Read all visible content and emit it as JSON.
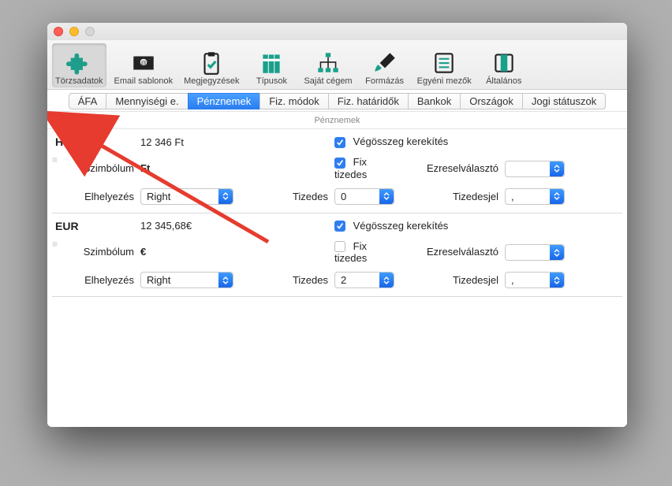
{
  "toolbar": [
    {
      "id": "torzsadatok",
      "label": "Törzsadatok"
    },
    {
      "id": "email",
      "label": "Email sablonok"
    },
    {
      "id": "megjegyzesek",
      "label": "Megjegyzések"
    },
    {
      "id": "tipusok",
      "label": "Típusok"
    },
    {
      "id": "sajat",
      "label": "Saját cégem"
    },
    {
      "id": "formazas",
      "label": "Formázás"
    },
    {
      "id": "egyeni",
      "label": "Egyéni mezők"
    },
    {
      "id": "altalanos",
      "label": "Általános"
    }
  ],
  "tabs": [
    {
      "label": "ÁFA"
    },
    {
      "label": "Mennyiségi e."
    },
    {
      "label": "Pénznemek",
      "active": true
    },
    {
      "label": "Fiz. módok"
    },
    {
      "label": "Fiz. határidők"
    },
    {
      "label": "Bankok"
    },
    {
      "label": "Országok"
    },
    {
      "label": "Jogi státuszok"
    }
  ],
  "listHeader": {
    "add": "+",
    "remove": "–",
    "title": "Pénznemek"
  },
  "labels": {
    "szimbolum": "Szimbólum",
    "elhelyezes": "Elhelyezés",
    "tizedes": "Tizedes",
    "vegosszeg": "Végösszeg kerekítés",
    "fix": "Fix tizedes",
    "ezres": "Ezreselválasztó",
    "tizedesjel": "Tizedesjel"
  },
  "currencies": [
    {
      "code": "HUF",
      "example": "12 346 Ft",
      "symbol": "Ft",
      "placement": "Right",
      "decimals": "0",
      "round": true,
      "fix": true,
      "thousand": " ",
      "decimalSep": ","
    },
    {
      "code": "EUR",
      "example": "12 345,68€",
      "symbol": "€",
      "placement": "Right",
      "decimals": "2",
      "round": true,
      "fix": false,
      "thousand": " ",
      "decimalSep": ","
    }
  ]
}
